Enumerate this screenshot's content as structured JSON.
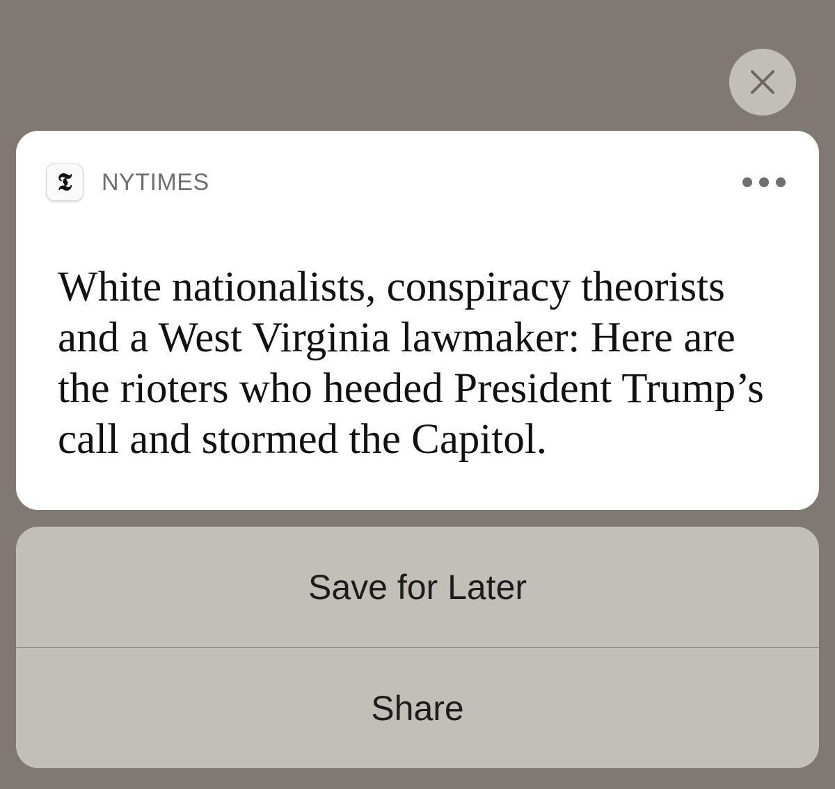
{
  "close": {
    "icon": "close-icon"
  },
  "notification": {
    "app_icon_glyph": "𝕿",
    "app_name": "NYTIMES",
    "more_icon": "ellipsis-icon",
    "headline": "White nationalists, conspiracy theorists and a West Virginia lawmaker: Here are the rioters who heeded President Trump’s call and stormed the Capitol."
  },
  "actions": {
    "save_label": "Save for Later",
    "share_label": "Share"
  },
  "colors": {
    "backdrop": "#7f7873",
    "card": "#ffffff",
    "action_sheet": "#c2beb8",
    "close_button": "#c2beb8"
  }
}
